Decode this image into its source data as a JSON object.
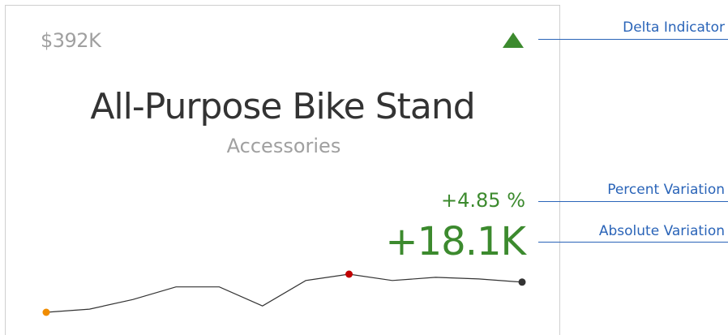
{
  "card": {
    "actual_value": "$392K",
    "title": "All-Purpose Bike Stand",
    "subtitle": "Accessories",
    "percent_variation": "+4.85 %",
    "absolute_variation": "+18.1K",
    "delta_direction": "up",
    "delta_color": "#3c8a2e"
  },
  "sparkline": {
    "values": [
      31,
      32,
      35,
      39,
      39,
      33,
      41,
      43,
      41,
      42,
      41.5,
      40.5
    ],
    "min_point_color": "#f08c00",
    "max_point_color": "#c00000",
    "end_point_color": "#333333",
    "line_color": "#333333"
  },
  "callouts": {
    "delta_indicator": "Delta Indicator",
    "percent_variation": "Percent Variation",
    "absolute_variation": "Absolute Variation"
  },
  "colors": {
    "callout": "#2a64b8",
    "muted_text": "#a0a0a0",
    "title_text": "#333333"
  }
}
